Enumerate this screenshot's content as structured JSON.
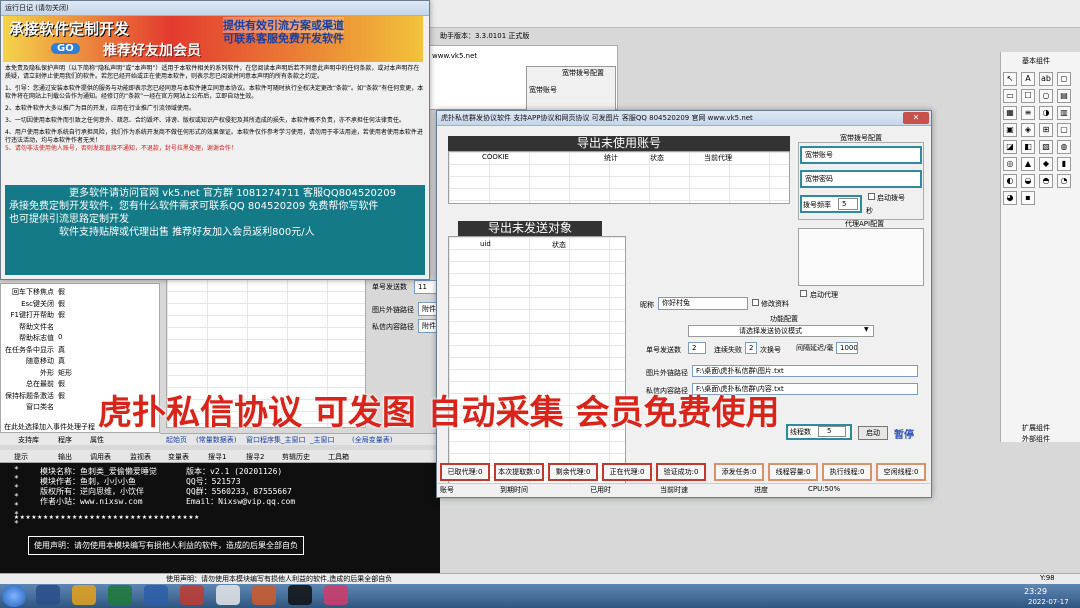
{
  "ide": {
    "title": "助手版本：3.3.0101 正式版",
    "url": "www.vk5.net",
    "right_title": "基本组件",
    "ext": "扩展组件",
    "ext2": "外部组件",
    "tabs": [
      "支持库",
      "程序",
      "属性"
    ],
    "bottom_tabs": [
      "起始页",
      "(常量数据表)",
      "窗口程序集_主窗口",
      "_主窗口",
      "(全局变量表)"
    ],
    "statusbar": "在此处选择加入事件处理子程",
    "statusbar2": "使用声明：请勿使用本模块编写有损他人利益的软件,造成的后果全部自负",
    "coord": "Y:98",
    "console_tabs": [
      "提示",
      "输出",
      "调用表",
      "监视表",
      "变量表",
      "搜寻1",
      "搜寻2",
      "剪辑历史",
      "工具箱"
    ]
  },
  "props": [
    [
      "回车下移焦点",
      "假"
    ],
    [
      "Esc键关闭",
      "假"
    ],
    [
      "F1键打开帮助",
      "假"
    ],
    [
      "帮助文件名",
      ""
    ],
    [
      "帮助标志值",
      "0"
    ],
    [
      "在任务条中显示",
      "真"
    ],
    [
      "随意移动",
      "真"
    ],
    [
      "外形",
      "矩形"
    ],
    [
      "总在最前",
      "假"
    ],
    [
      "保持标题条激活",
      "假"
    ],
    [
      "窗口类名",
      ""
    ]
  ],
  "mid": {
    "labels": [
      "单号发送数",
      "图片外链路径",
      "私信内容路径"
    ],
    "vals": [
      "11",
      "附件图",
      "附件图"
    ],
    "bottom": [
      "账号",
      "到期时间",
      "在线状态"
    ]
  },
  "log": {
    "title": "运行日记 (请勿关闭)",
    "banner1": "承接软件定制开发",
    "banner2": "提供有效引流方案或渠道",
    "banner3": "可联系客服免费开发软件",
    "banner4": "推荐好友加会员",
    "banner_go": "GO",
    "p1": "本免责及隐私保护声明（以下简称“隐私声明”或“本声明”）适用于本软件相关的系列软件，在您阅读本声明后若不同意此声明中的任何条款，或对本声明存在质疑，请立刻停止使用我们的软件。若您已经开始或正在使用本软件，则表示您已阅读并同意本声明的所有条款之约定。",
    "p2": "1、引导：您通过安装本软件提供的服务与功能即表示您已经同意与本软件建立同意本协议。本软件可随时执行全权决定更改“条款”。如“条款”有任何变更，本软件将在网站上刊载公告作为通知。经修订的“条款”一经在官方网站上公布后，立即自动生效。",
    "p3": "2、本软件软件大多以推广为目的开发，应用在行业推广引流领域使用。",
    "p4": "3、一切因使用本软件而引致之任何意外、疏忽、合约毁坏、诽谤、版权或知识产权侵犯及其所造成的损失，本软件概不负责，亦不承担任何法律责任。",
    "p5": "4、用户使用本软件系统自行承担风险，我们作为系统开发商不做任何形式的效果保证。本软件仅作参考学习使用，请勿用于非法用途，若使用者使用本软件进行违法活动，均与本软件作者无关！",
    "red": "5、请勿非法使用他人账号，否则发现直接不通知，不退款，封号拉黑处理，谢谢合作！",
    "teal1": "更多软件请访问官网 vk5.net  官方群 1081274711  客服QQ804520209",
    "teal2": "承接免费定制开发软件，您有什么软件需求可联系QQ 804520209 免费帮你写软件",
    "teal3": "也可提供引流思路定制开发",
    "teal4": "软件支持贴牌或代理出售 推荐好友加入会员返利800元/人"
  },
  "app": {
    "title": "虎扑私信群发协议软件 支持APP协议和网页协议 可发图片 客服QQ 804520209 官网 www.vk5.net",
    "unused_header": "导出未使用账号",
    "unused_cols": [
      "COOKIE",
      "统计",
      "状态",
      "当前代理"
    ],
    "unsent_header": "导出未发送对象",
    "unsent_cols": [
      "uid",
      "状态"
    ],
    "acct_cfg": "宽带拨号配置",
    "acct_label": "宽带账号",
    "pwd_label": "宽带密码",
    "dial_label": "拨号频率",
    "dial_val": "5",
    "dial_unit": "秒",
    "dial_toggle": "启动拨号",
    "proxy_cfg": "代理API配置",
    "proxy_toggle": "启动代理",
    "nick_label": "昵称",
    "nick_val": "你好村兔",
    "modify_label": "修改资料",
    "func_cfg": "功能配置",
    "mode": "请选择发送协议模式",
    "single_label": "单号发送数",
    "single_val": "2",
    "fail_label": "连续失败",
    "fail_val": "2",
    "switch_label": "次换号",
    "delay_label": "间隔延迟/毫",
    "delay_val": "1000",
    "img_label": "图片外链路径",
    "img_val": "F:\\桌面\\虎扑私信群\\图片.txt",
    "msg_label": "私信内容路径",
    "msg_val": "F:\\桌面\\虎扑私信群\\内容.txt",
    "thread_label": "线程数",
    "thread_val": "5",
    "start": "启动",
    "pause": "暂停",
    "stats": [
      [
        "已取代理",
        "0"
      ],
      [
        "本次提取数",
        "0"
      ],
      [
        "剩余代理",
        "0"
      ],
      [
        "正在代理",
        "0"
      ],
      [
        "验证成功",
        "0"
      ],
      [
        "添发任务",
        "0"
      ],
      [
        "线程容量",
        "0"
      ],
      [
        "执行线程",
        "0"
      ],
      [
        "空闲线程",
        "0"
      ]
    ],
    "status": [
      "账号",
      "到期时间",
      "已用时",
      "当前时速",
      "进度",
      "CPU:50%"
    ]
  },
  "overlay": "虎扑私信协议 可发图 自动采集 会员免费使用",
  "module": {
    "l1": "模块名称：鱼刺类_爱偷懒爱睡觉",
    "v1": "版本：v2.1 (20201126)",
    "l2": "模块作者：鱼刺，小小小鱼",
    "v2": "QQ号：521573",
    "l3": "版权所有：逆向思维，小饮伴",
    "v3": "QQ群：5560233，87555667",
    "l4": "作者小站：www.nixsw.com",
    "v4": "Email：Nixsw@vip.qq.com",
    "notice": "使用声明：请勿使用本模块编写有损他人利益的软件，造成的后果全部自负"
  },
  "clock": {
    "time": "23:29",
    "date": "2022-07-17"
  },
  "colors": {
    "teal": "#147a87",
    "red": "#c23a2e",
    "banner": "#d63b2d"
  }
}
